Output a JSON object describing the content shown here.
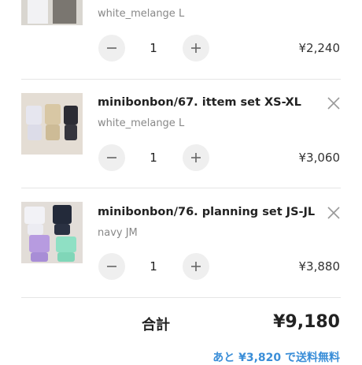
{
  "cart": {
    "items": [
      {
        "name": "",
        "variant": "white_melange L",
        "quantity": "1",
        "price": "¥2,240",
        "thumbnail": "clothing-set-photo"
      },
      {
        "name": "minibonbon/67. ittem set XS-XL",
        "variant": "white_melange L",
        "quantity": "1",
        "price": "¥3,060",
        "thumbnail": "clothing-set-photo"
      },
      {
        "name": "minibonbon/76. planning set JS-JL",
        "variant": "navy JM",
        "quantity": "1",
        "price": "¥3,880",
        "thumbnail": "clothing-set-photo"
      }
    ],
    "icons": {
      "minus": "minus-icon",
      "plus": "plus-icon",
      "remove": "close-icon"
    },
    "total_label": "合計",
    "total_value": "¥9,180",
    "free_shipping_note": "あと ¥3,820 で送料無料"
  },
  "colors": {
    "accent": "#3a8ed8",
    "stepper_bg": "#efefef",
    "text": "#222222",
    "muted": "#888888"
  }
}
